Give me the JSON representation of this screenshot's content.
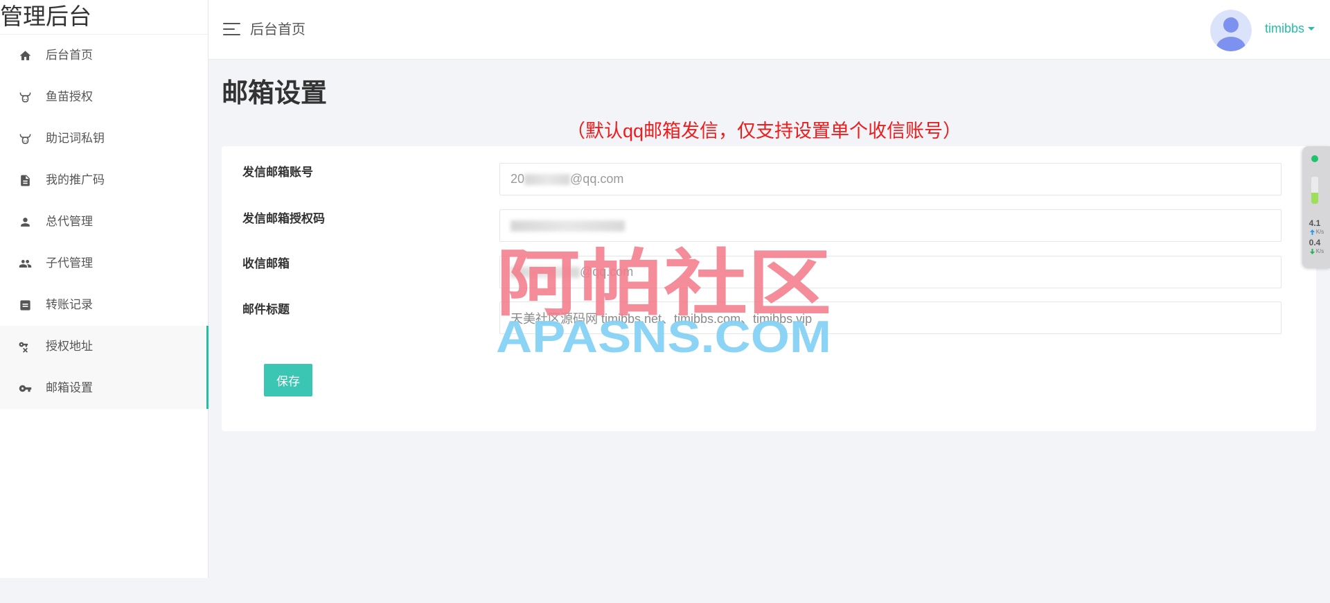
{
  "brand": "管理后台",
  "sidebar": {
    "items": [
      {
        "label": "后台首页",
        "icon": "home-icon"
      },
      {
        "label": "鱼苗授权",
        "icon": "bull-head-icon"
      },
      {
        "label": "助记词私钥",
        "icon": "bull-head-icon"
      },
      {
        "label": "我的推广码",
        "icon": "document-icon"
      },
      {
        "label": "总代管理",
        "icon": "person-icon"
      },
      {
        "label": "子代管理",
        "icon": "people-icon"
      },
      {
        "label": "转账记录",
        "icon": "list-box-icon"
      },
      {
        "label": "授权地址",
        "icon": "key-remove-icon",
        "highlighted": true
      },
      {
        "label": "邮箱设置",
        "icon": "key-icon",
        "highlighted": true
      }
    ]
  },
  "header": {
    "menu_icon": "hamburger-icon",
    "breadcrumb": "后台首页",
    "avatar_icon": "user-avatar-icon",
    "username": "timibbs"
  },
  "page": {
    "title": "邮箱设置",
    "notice": "（默认qq邮箱发信，仅支持设置单个收信账号）"
  },
  "form": {
    "fields": [
      {
        "label": "发信邮箱账号",
        "value_start": "20",
        "value_end": "@qq.com",
        "redacted": true
      },
      {
        "label": "发信邮箱授权码",
        "redacted": true
      },
      {
        "label": "收信邮箱",
        "value_end": "@qq.com",
        "redacted": true
      },
      {
        "label": "邮件标题",
        "value": "天美社区源码网 timibbs.net、timibbs.com、timibbs.vip"
      }
    ],
    "save_label": "保存"
  },
  "watermark": {
    "text_cn": "阿帕社区",
    "text_en": "APASNS.COM"
  },
  "speed_widget": {
    "upload": "4.1",
    "download": "0.4",
    "unit": "K/s",
    "gauge_level": 0.4
  },
  "colors": {
    "accent": "#22bfa6",
    "button": "#3bc5b3",
    "notice": "#ee1c1c",
    "watermark_cn": "#f47c8b",
    "watermark_en": "#86d2f4",
    "page_bg": "#f3f4f8",
    "status_dot": "#1ec46b"
  }
}
